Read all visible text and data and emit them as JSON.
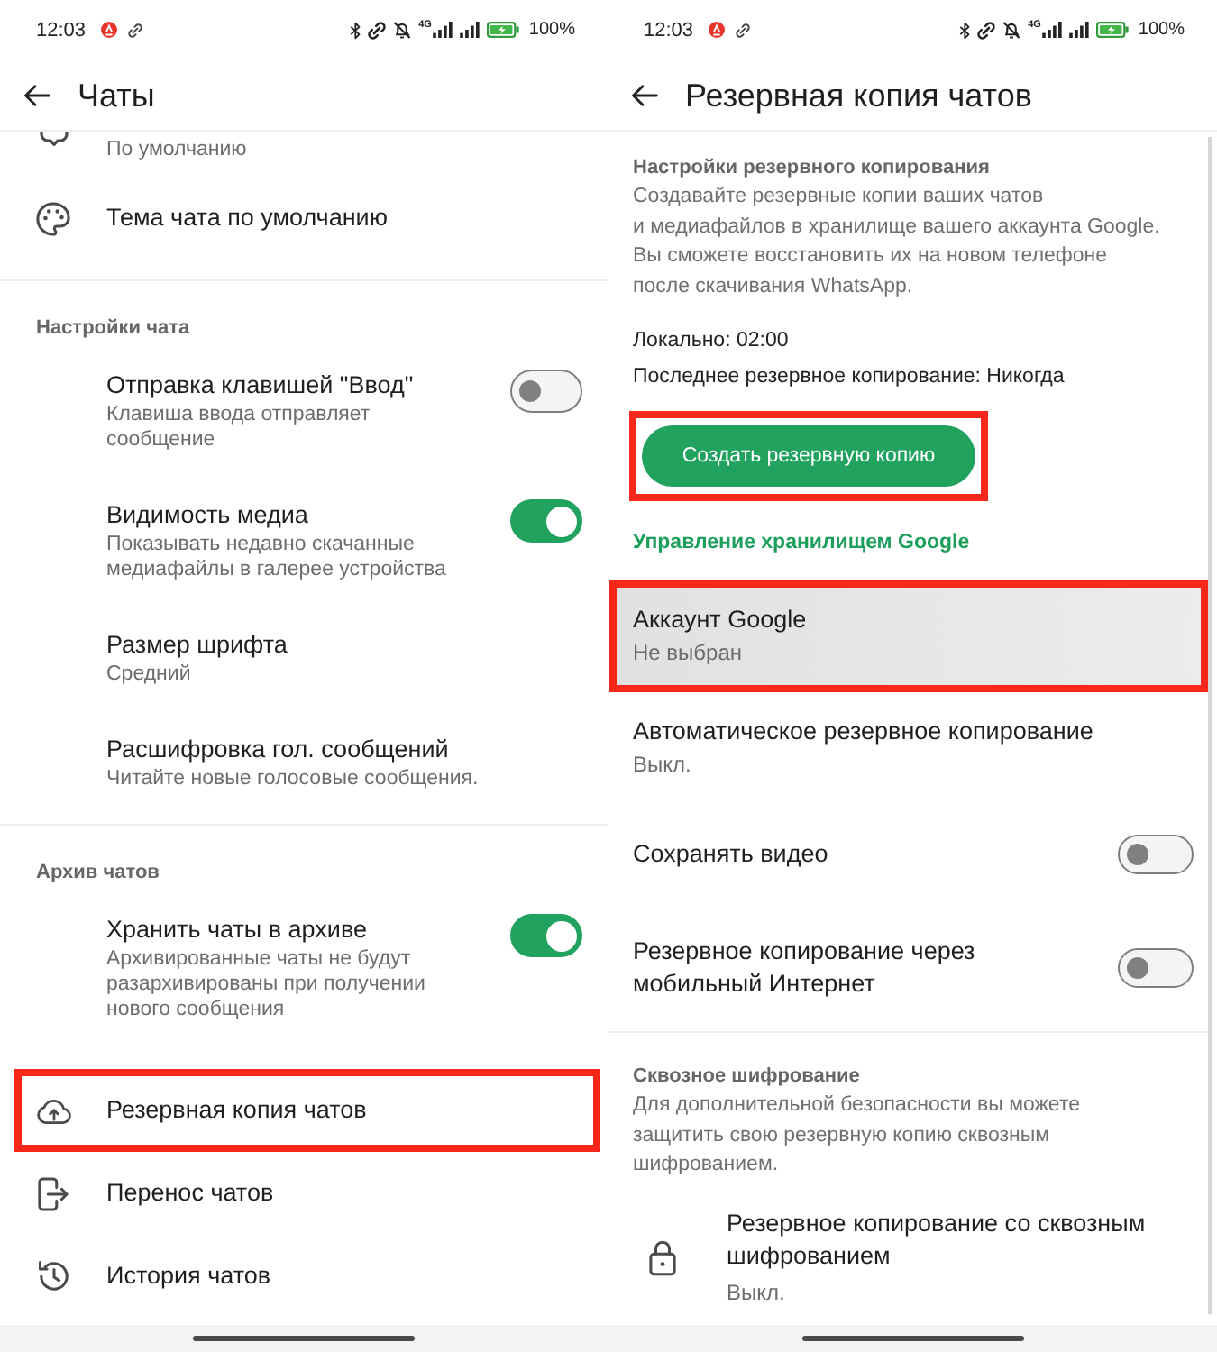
{
  "screens": [
    {
      "status_bar": {
        "time": "12:03",
        "network": "4G",
        "battery": "100%"
      },
      "toolbar": {
        "title": "Чаты"
      },
      "sections": [
        {
          "blocks": [
            {
              "kind": "item",
              "icon": true,
              "subtitle": "По умолчанию",
              "highlighted": false,
              "pressed": false
            },
            {
              "kind": "item",
              "icon": true,
              "title": "Тема чата по умолчанию",
              "highlighted": false,
              "pressed": false
            }
          ]
        },
        {
          "blocks": [
            {
              "kind": "heading",
              "text": "Настройки чата"
            },
            {
              "kind": "toggle",
              "title": "Отправка клавишей \"Ввод\"",
              "subtitle": "Клавиша ввода отправляет\nсообщение",
              "on": false,
              "highlighted": false,
              "pressed": false
            },
            {
              "kind": "toggle",
              "title": "Видимость медиа",
              "subtitle": "Показывать недавно скачанные\nмедиафайлы в галерее устройства",
              "on": true,
              "highlighted": false,
              "pressed": false
            },
            {
              "kind": "item",
              "title": "Размер шрифта",
              "subtitle": "Средний",
              "highlighted": false,
              "pressed": false
            },
            {
              "kind": "item",
              "title": "Расшифровка гол. сообщений",
              "subtitle": "Читайте новые голосовые сообщения.",
              "highlighted": false,
              "pressed": false
            }
          ]
        },
        {
          "blocks": [
            {
              "kind": "heading",
              "text": "Архив чатов"
            },
            {
              "kind": "toggle",
              "title": "Хранить чаты в архиве",
              "subtitle": "Архивированные чаты не будут\nразархивированы при получении\nнового сообщения",
              "on": true,
              "highlighted": false,
              "pressed": false
            },
            {
              "kind": "item",
              "icon": true,
              "title": "Резервная копия чатов",
              "highlighted": true,
              "pressed": false
            },
            {
              "kind": "item",
              "icon": true,
              "title": "Перенос чатов",
              "highlighted": false,
              "pressed": false
            },
            {
              "kind": "item",
              "icon": true,
              "title": "История чатов",
              "highlighted": false,
              "pressed": false
            }
          ]
        }
      ]
    },
    {
      "status_bar": {
        "time": "12:03",
        "network": "4G",
        "battery": "100%"
      },
      "toolbar": {
        "title": "Резервная копия чатов"
      },
      "sections": [
        {
          "blocks": [
            {
              "kind": "heading",
              "text": "Настройки резервного копирования"
            },
            {
              "kind": "text",
              "text": "Создавайте резервные копии ваших чатов\nи медиафайлов в хранилище вашего аккаунта Google.\nВы сможете восстановить их на новом телефоне\nпосле скачивания WhatsApp."
            },
            {
              "kind": "info",
              "text": "Локально: 02:00"
            },
            {
              "kind": "info",
              "text": "Последнее резервное копирование: Никогда"
            },
            {
              "kind": "button",
              "label": "Создать резервную копию",
              "highlighted": true
            },
            {
              "kind": "category",
              "text": "Управление хранилищем Google"
            },
            {
              "kind": "item",
              "title": "Аккаунт Google",
              "subtitle": "Не выбран",
              "highlighted": true,
              "pressed": true
            },
            {
              "kind": "item",
              "title": "Автоматическое резервное копирование",
              "subtitle": "Выкл.",
              "highlighted": false,
              "pressed": false
            },
            {
              "kind": "toggle",
              "title": "Сохранять видео",
              "on": false,
              "highlighted": false,
              "pressed": false
            },
            {
              "kind": "toggle",
              "title": "Резервное копирование через\nмобильный Интернет",
              "on": false,
              "highlighted": false,
              "pressed": false
            }
          ]
        },
        {
          "blocks": [
            {
              "kind": "heading",
              "text": "Сквозное шифрование"
            },
            {
              "kind": "text",
              "text": "Для дополнительной безопасности вы можете\nзащитить свою резервную копию сквозным\nшифрованием."
            },
            {
              "kind": "item",
              "icon": true,
              "title": "Резервное копирование со сквозным\nшифрованием",
              "subtitle": "Выкл.",
              "highlighted": false,
              "pressed": false
            }
          ]
        }
      ]
    }
  ]
}
